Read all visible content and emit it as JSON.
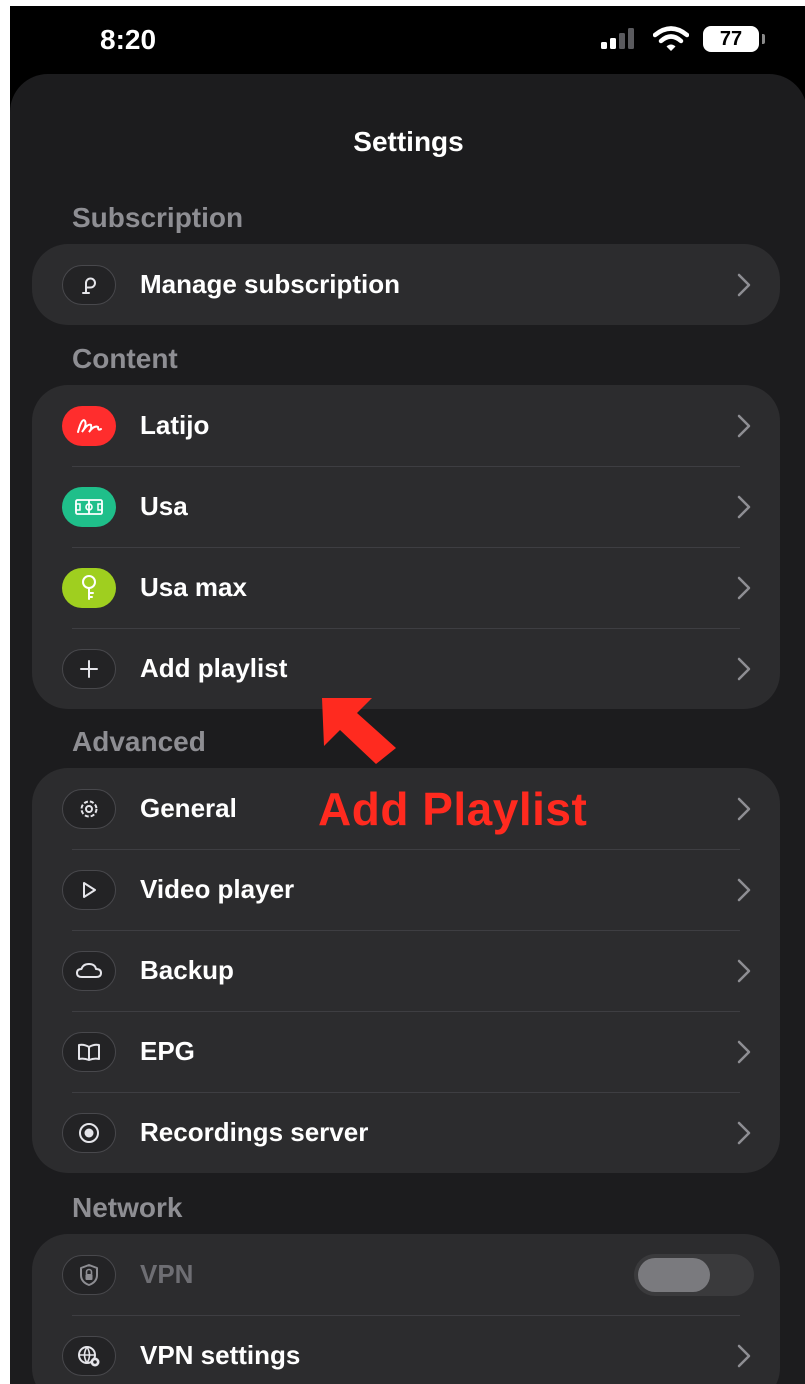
{
  "status_bar": {
    "time": "8:20",
    "battery": "77"
  },
  "title": "Settings",
  "sections": {
    "subscription": {
      "header": "Subscription",
      "items": [
        {
          "label": "Manage subscription",
          "icon": "subscription-icon"
        }
      ]
    },
    "content": {
      "header": "Content",
      "items": [
        {
          "label": "Latijo",
          "icon": "signature-icon",
          "icon_color": "#ff2d2d"
        },
        {
          "label": "Usa",
          "icon": "soccer-field-icon",
          "icon_color": "#1fbf8a"
        },
        {
          "label": "Usa max",
          "icon": "key-icon",
          "icon_color": "#9fcf1f"
        },
        {
          "label": "Add playlist",
          "icon": "plus-icon"
        }
      ]
    },
    "advanced": {
      "header": "Advanced",
      "items": [
        {
          "label": "General",
          "icon": "gear-icon"
        },
        {
          "label": "Video player",
          "icon": "play-icon"
        },
        {
          "label": "Backup",
          "icon": "cloud-icon"
        },
        {
          "label": "EPG",
          "icon": "book-icon"
        },
        {
          "label": "Recordings server",
          "icon": "record-icon"
        }
      ]
    },
    "network": {
      "header": "Network",
      "items": [
        {
          "label": "VPN",
          "icon": "shield-lock-icon",
          "toggle_on": false
        },
        {
          "label": "VPN settings",
          "icon": "globe-gear-icon"
        }
      ]
    }
  },
  "annotation": {
    "text": "Add Playlist",
    "color": "#ff2a1f"
  }
}
